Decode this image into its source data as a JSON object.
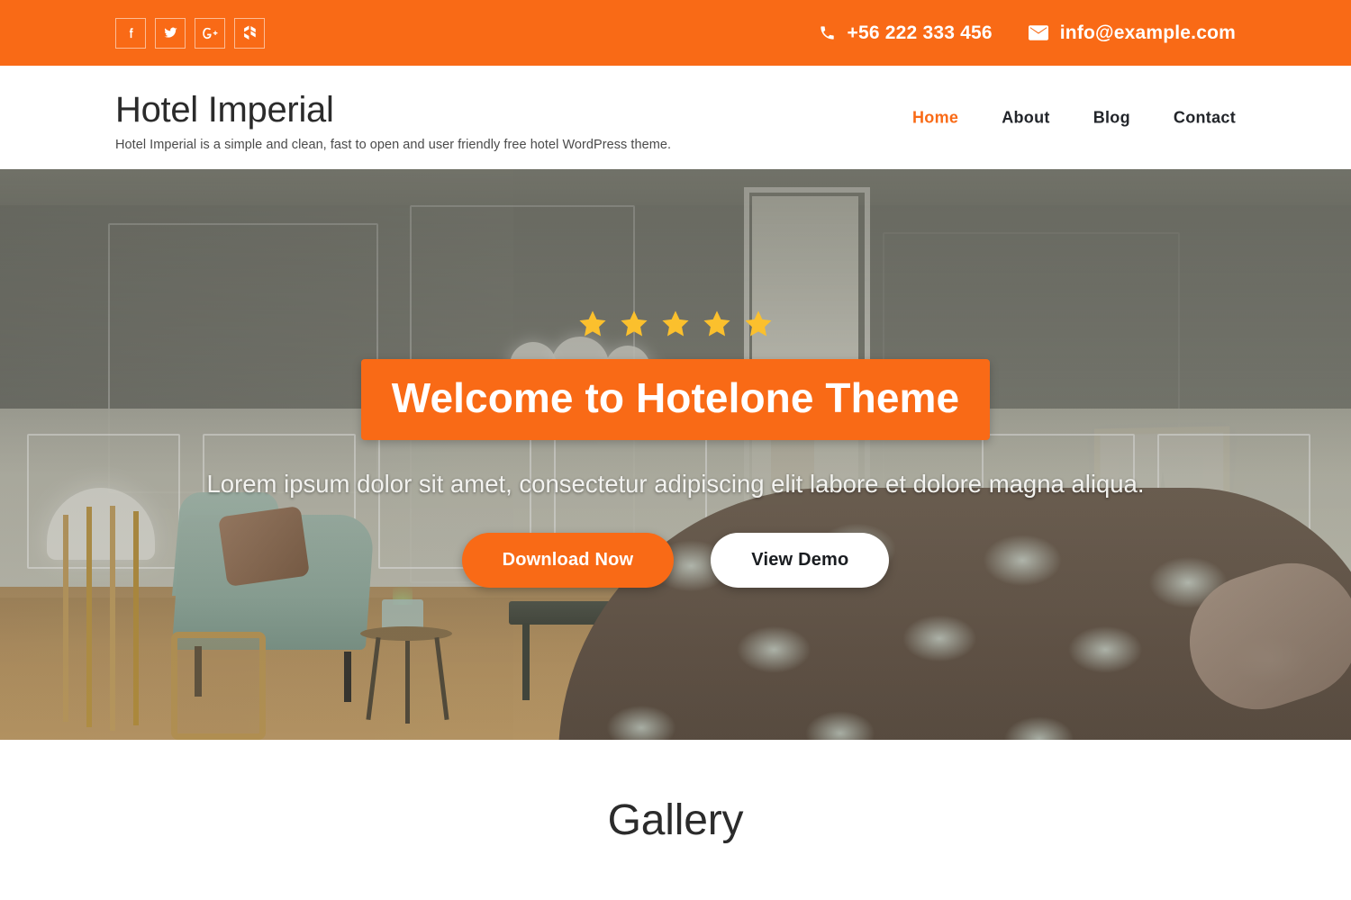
{
  "colors": {
    "accent": "#f96a16",
    "star": "#fbc02d",
    "nav_text": "#22252a",
    "body_text": "#2b2b2b"
  },
  "topbar": {
    "social": [
      {
        "name": "facebook-icon",
        "label": "Facebook"
      },
      {
        "name": "twitter-icon",
        "label": "Twitter"
      },
      {
        "name": "google-plus-icon",
        "label": "Google Plus"
      },
      {
        "name": "houzz-icon",
        "label": "Houzz"
      }
    ],
    "phone": {
      "icon": "phone-icon",
      "text": "+56 222 333 456"
    },
    "email": {
      "icon": "envelope-icon",
      "text": "info@example.com"
    }
  },
  "header": {
    "site_title": "Hotel Imperial",
    "tagline": "Hotel Imperial is a simple and clean, fast to open and user friendly free hotel WordPress theme.",
    "nav": [
      {
        "label": "Home",
        "active": true
      },
      {
        "label": "About",
        "active": false
      },
      {
        "label": "Blog",
        "active": false
      },
      {
        "label": "Contact",
        "active": false
      }
    ]
  },
  "hero": {
    "rating_stars": 5,
    "title": "Welcome to Hotelone Theme",
    "subtitle": "Lorem ipsum dolor sit amet, consectetur adipiscing elit labore et dolore magna aliqua.",
    "primary_button": "Download Now",
    "secondary_button": "View Demo"
  },
  "gallery": {
    "title": "Gallery"
  }
}
